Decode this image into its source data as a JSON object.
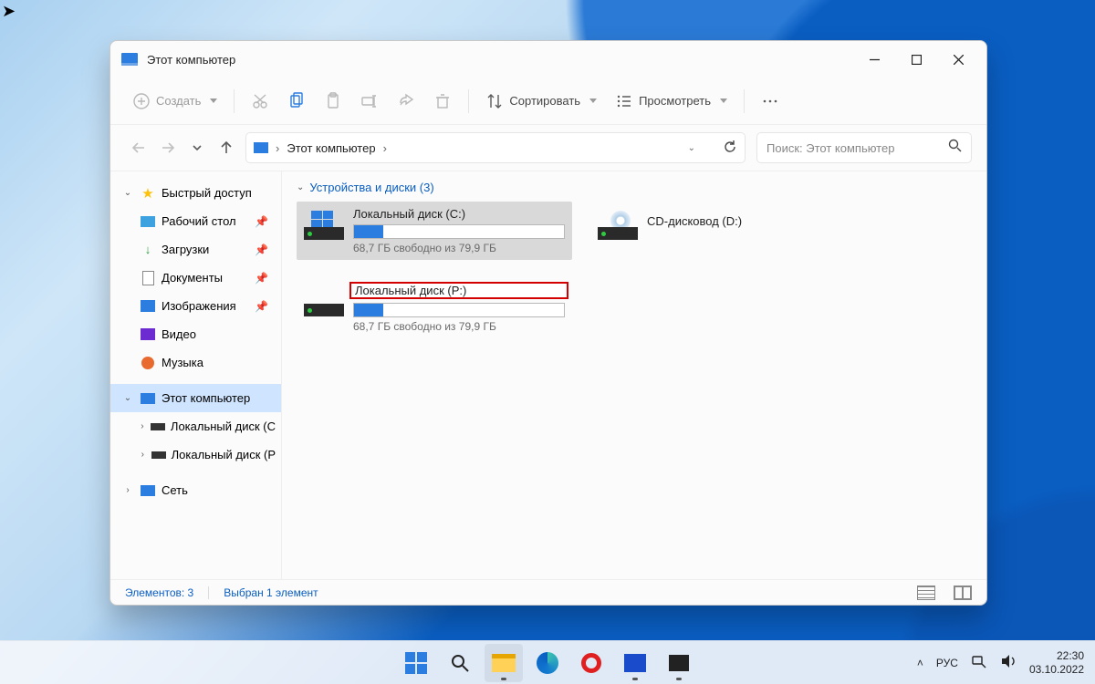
{
  "window": {
    "title": "Этот компьютер"
  },
  "toolbar": {
    "new": "Создать",
    "sort": "Сортировать",
    "view": "Просмотреть"
  },
  "address": {
    "segment": "Этот компьютер"
  },
  "search": {
    "placeholder": "Поиск: Этот компьютер"
  },
  "sidebar": {
    "quick": "Быстрый доступ",
    "desktop": "Рабочий стол",
    "downloads": "Загрузки",
    "documents": "Документы",
    "pictures": "Изображения",
    "videos": "Видео",
    "music": "Музыка",
    "thispc": "Этот компьютер",
    "driveC": "Локальный диск (C",
    "driveP": "Локальный диск (P",
    "network": "Сеть"
  },
  "content": {
    "group_header": "Устройства и диски (3)",
    "driveC": {
      "name": "Локальный диск (C:)",
      "sub": "68,7 ГБ свободно из 79,9 ГБ",
      "fill_percent": 14
    },
    "cd": {
      "name": "CD-дисковод (D:)"
    },
    "driveP": {
      "name": "Локальный диск (P:)",
      "sub": "68,7 ГБ свободно из 79,9 ГБ",
      "fill_percent": 14
    }
  },
  "statusbar": {
    "count": "Элементов: 3",
    "selected": "Выбран 1 элемент"
  },
  "tray": {
    "lang": "РУС",
    "time": "22:30",
    "date": "03.10.2022"
  }
}
